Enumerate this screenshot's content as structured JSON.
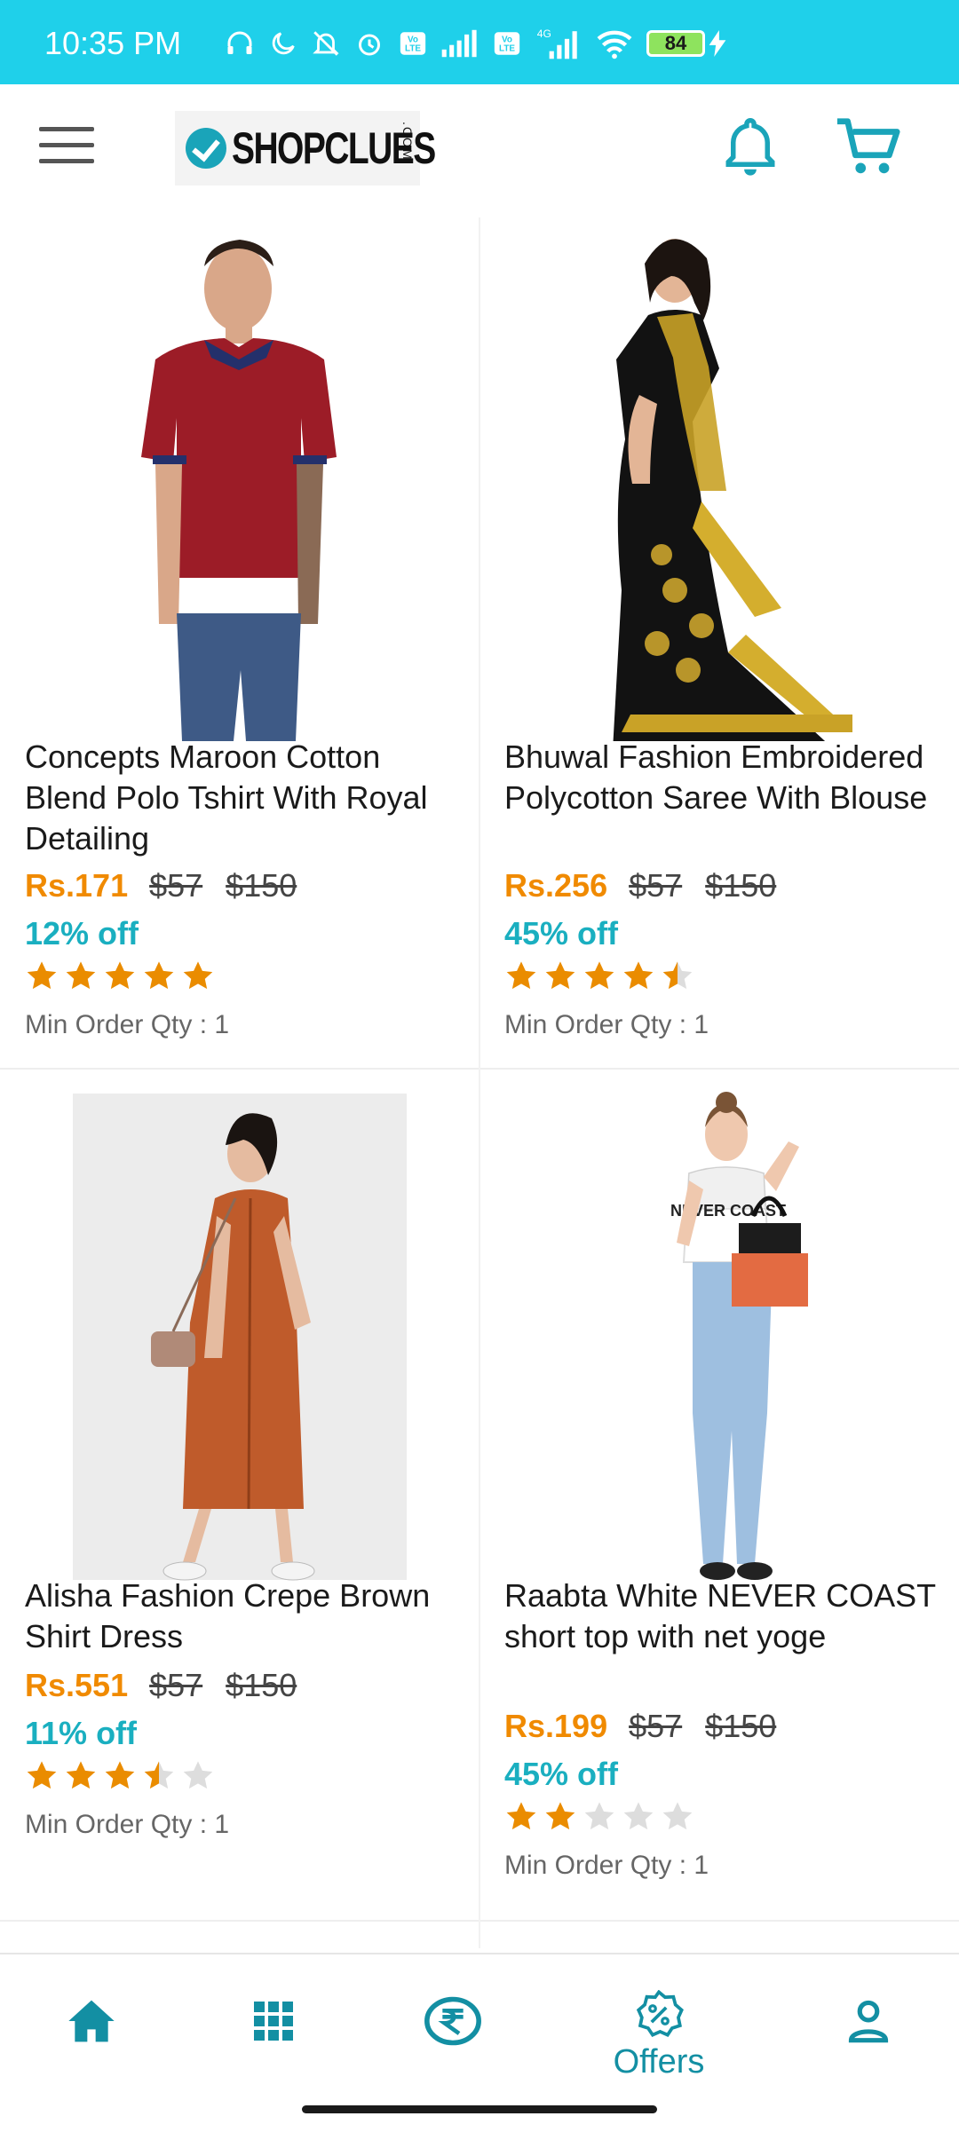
{
  "status_bar": {
    "time": "10:35 PM",
    "battery": "84",
    "network_label": "4G",
    "volte_label": "Vo LTE",
    "icons": [
      "headphones-icon",
      "moon-icon",
      "bell-off-icon",
      "alarm-icon",
      "volte-icon",
      "signal-icon",
      "wifi-icon",
      "battery-icon",
      "charging-icon"
    ]
  },
  "header": {
    "logo_text": "SHOPCLUES",
    "logo_suffix": ".COM",
    "icons": [
      "menu-icon",
      "notification-bell-icon",
      "cart-icon"
    ]
  },
  "colors": {
    "accent": "#1aa4b9",
    "status_bar": "#1fd0ea",
    "price": "#f08a00",
    "discount": "#1aafc0",
    "star": "#ea8c00",
    "star_empty": "#dddddd"
  },
  "products": [
    {
      "title": "Concepts Maroon Cotton Blend Polo Tshirt With Royal Detailing",
      "price": "Rs.171",
      "mrp1": "$57",
      "mrp2": "$150",
      "discount": "12% off",
      "rating": 5,
      "min_order": "Min Order Qty : 1"
    },
    {
      "title": "Bhuwal Fashion Embroidered Polycotton Saree With Blouse",
      "price": "Rs.256",
      "mrp1": "$57",
      "mrp2": "$150",
      "discount": "45% off",
      "rating": 4.5,
      "min_order": "Min Order Qty : 1"
    },
    {
      "title": "Alisha Fashion Crepe Brown Shirt Dress",
      "price": "Rs.551",
      "mrp1": "$57",
      "mrp2": "$150",
      "discount": "11% off",
      "rating": 3.5,
      "min_order": "Min Order Qty : 1"
    },
    {
      "title": "Raabta White NEVER COAST short top with net yoge",
      "price": "Rs.199",
      "mrp1": "$57",
      "mrp2": "$150",
      "discount": "45% off",
      "rating": 2,
      "min_order": "Min Order Qty : 1",
      "shirt_print": "NEVER COAST"
    }
  ],
  "bottom_nav": {
    "items": [
      {
        "icon": "home-icon"
      },
      {
        "icon": "categories-grid-icon"
      },
      {
        "icon": "rupee-icon"
      },
      {
        "icon": "offers-badge-icon",
        "label": "Offers"
      },
      {
        "icon": "profile-icon"
      }
    ]
  }
}
